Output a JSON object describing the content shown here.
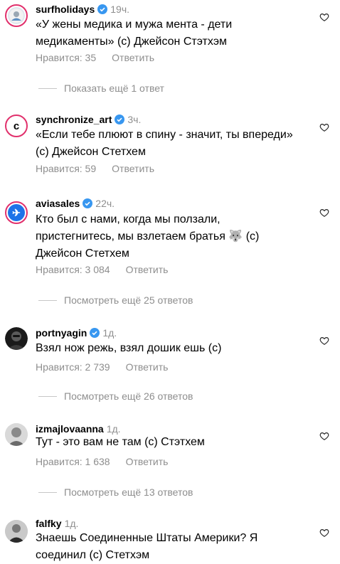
{
  "comments": [
    {
      "user": "surfholidays",
      "time": "19ч.",
      "text": "«У жены медика и мужа мента - дети медикаменты» (с) Джейсон Стэтхэм",
      "likes": "Нравится: 35",
      "reply": "Ответить",
      "more": "Показать ещё 1 ответ",
      "avatar_colors": [
        "#e9e9e9",
        "#7aa7d6"
      ]
    },
    {
      "user": "synchronize_art",
      "time": "3ч.",
      "text": "«Если тебе плюют в спину - значит, ты впереди» (с) Джейсон Стетхем",
      "likes": "Нравится: 59",
      "reply": "Ответить",
      "avatar_glyph": "c"
    },
    {
      "user": "aviasales",
      "time": "22ч.",
      "text": "Кто был с нами, когда мы ползали, пристегнитесь, мы взлетаем братья 🐺 (с) Джейсон Стетхем",
      "likes": "Нравится: 3 084",
      "reply": "Ответить",
      "more": "Посмотреть ещё 25 ответов",
      "avatar_glyph": "✈"
    },
    {
      "user": "portnyagin",
      "time": "1д.",
      "text": "Взял нож режь, взял дошик ешь (с)",
      "likes": "Нравится: 2 739",
      "reply": "Ответить",
      "more": "Посмотреть ещё 26 ответов"
    },
    {
      "user": "izmajlovaanna",
      "time": "1д.",
      "text": "Тут - это вам не там (с) Стэтхем",
      "likes": "Нравится: 1 638",
      "reply": "Ответить",
      "more": "Посмотреть ещё 13 ответов"
    },
    {
      "user": "falfky",
      "time": "1д.",
      "text": "Знаешь Соединенные Штаты Америки? Я соединил (с) Стетхэм"
    }
  ],
  "colors": {
    "verified": "#3897f0",
    "muted": "#8e8e8e",
    "ring": "#e1306c"
  }
}
